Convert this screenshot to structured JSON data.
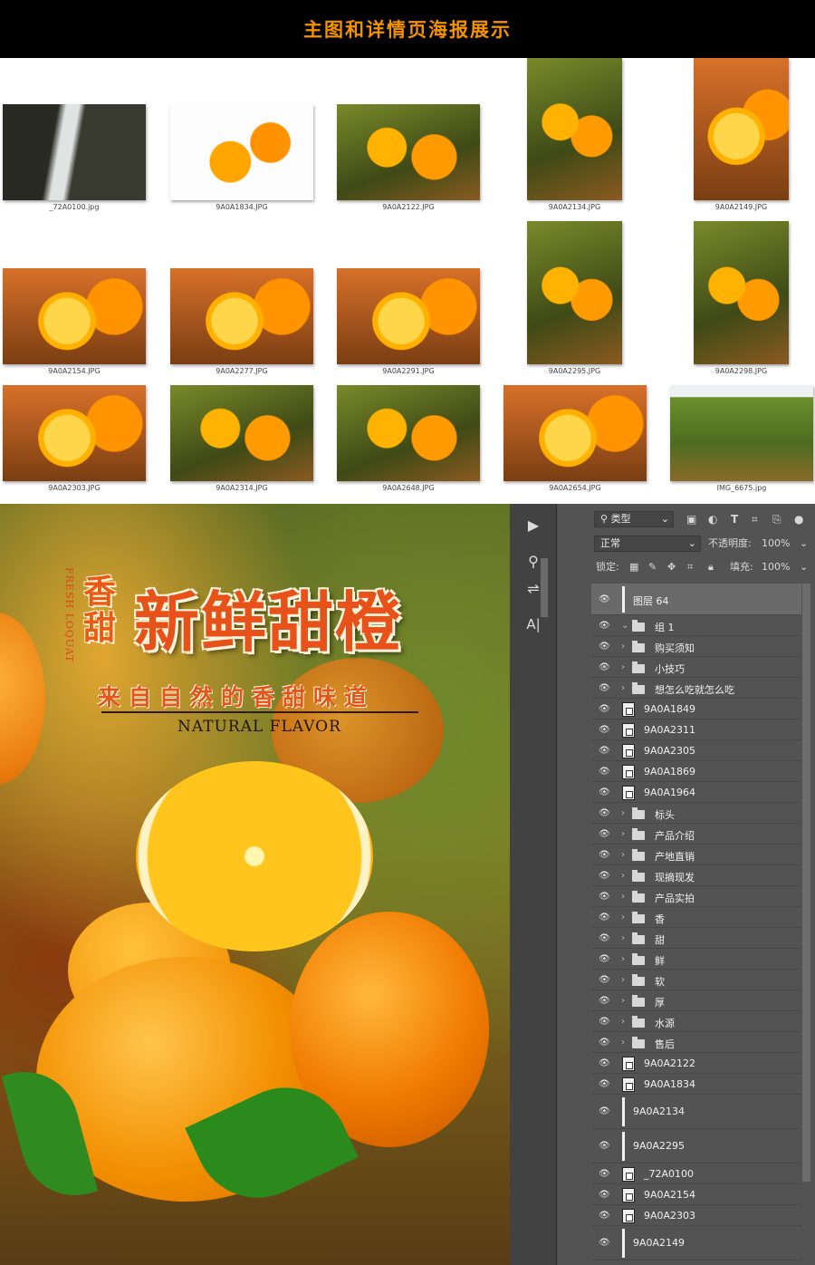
{
  "banner": {
    "title": "主图和详情页海报展示"
  },
  "gallery": {
    "thumbs": [
      {
        "caption": "_72A0100.jpg"
      },
      {
        "caption": "9A0A1834.JPG"
      },
      {
        "caption": "9A0A2122.JPG"
      },
      {
        "caption": "9A0A2134.JPG"
      },
      {
        "caption": "9A0A2149.JPG"
      },
      {
        "caption": "9A0A2154.JPG"
      },
      {
        "caption": "9A0A2277.JPG"
      },
      {
        "caption": "9A0A2291.JPG"
      },
      {
        "caption": "9A0A2295.JPG"
      },
      {
        "caption": "9A0A2298.JPG"
      },
      {
        "caption": "9A0A2303.JPG"
      },
      {
        "caption": "9A0A2314.JPG"
      },
      {
        "caption": "9A0A2648.JPG"
      },
      {
        "caption": "9A0A2654.JPG"
      },
      {
        "caption": "IMG_6675.jpg"
      }
    ]
  },
  "poster": {
    "side_text": "FRESH LOQUAT",
    "small_chars": "香甜",
    "title": "新鲜甜橙",
    "subtitle": "来自自然的香甜味道",
    "english": "NATURAL FLAVOR"
  },
  "photoshop": {
    "filter_kind": "类型",
    "blend_mode": "正常",
    "opacity_label": "不透明度:",
    "opacity_value": "100%",
    "lock_label": "锁定:",
    "fill_label": "填充:",
    "fill_value": "100%",
    "layers": [
      {
        "name": "图层 64",
        "kind": "thumb",
        "selected": true,
        "expanded": false
      },
      {
        "name": "组 1",
        "kind": "folder",
        "expanded": true
      },
      {
        "name": "购买须知",
        "kind": "folder"
      },
      {
        "name": "小技巧",
        "kind": "folder"
      },
      {
        "name": "想怎么吃就怎么吃",
        "kind": "folder"
      },
      {
        "name": "9A0A1849",
        "kind": "smart"
      },
      {
        "name": "9A0A2311",
        "kind": "smart"
      },
      {
        "name": "9A0A2305",
        "kind": "smart"
      },
      {
        "name": "9A0A1869",
        "kind": "smart"
      },
      {
        "name": "9A0A1964",
        "kind": "smart"
      },
      {
        "name": "标头",
        "kind": "folder"
      },
      {
        "name": "产品介绍",
        "kind": "folder"
      },
      {
        "name": "产地直销",
        "kind": "folder"
      },
      {
        "name": "现摘现发",
        "kind": "folder"
      },
      {
        "name": "产品实拍",
        "kind": "folder"
      },
      {
        "name": "香",
        "kind": "folder"
      },
      {
        "name": "甜",
        "kind": "folder"
      },
      {
        "name": "鲜",
        "kind": "folder"
      },
      {
        "name": "软",
        "kind": "folder"
      },
      {
        "name": "厚",
        "kind": "folder"
      },
      {
        "name": "水源",
        "kind": "folder"
      },
      {
        "name": "售后",
        "kind": "folder"
      },
      {
        "name": "9A0A2122",
        "kind": "smart"
      },
      {
        "name": "9A0A1834",
        "kind": "smart"
      },
      {
        "name": "9A0A2134",
        "kind": "tall"
      },
      {
        "name": "9A0A2295",
        "kind": "tall"
      },
      {
        "name": "_72A0100",
        "kind": "smart"
      },
      {
        "name": "9A0A2154",
        "kind": "smart"
      },
      {
        "name": "9A0A2303",
        "kind": "smart"
      },
      {
        "name": "9A0A2149",
        "kind": "tall"
      }
    ]
  },
  "colors": {
    "accent_orange": "#f39200",
    "ps_panel": "#535353",
    "ps_toolbar": "#424242"
  }
}
